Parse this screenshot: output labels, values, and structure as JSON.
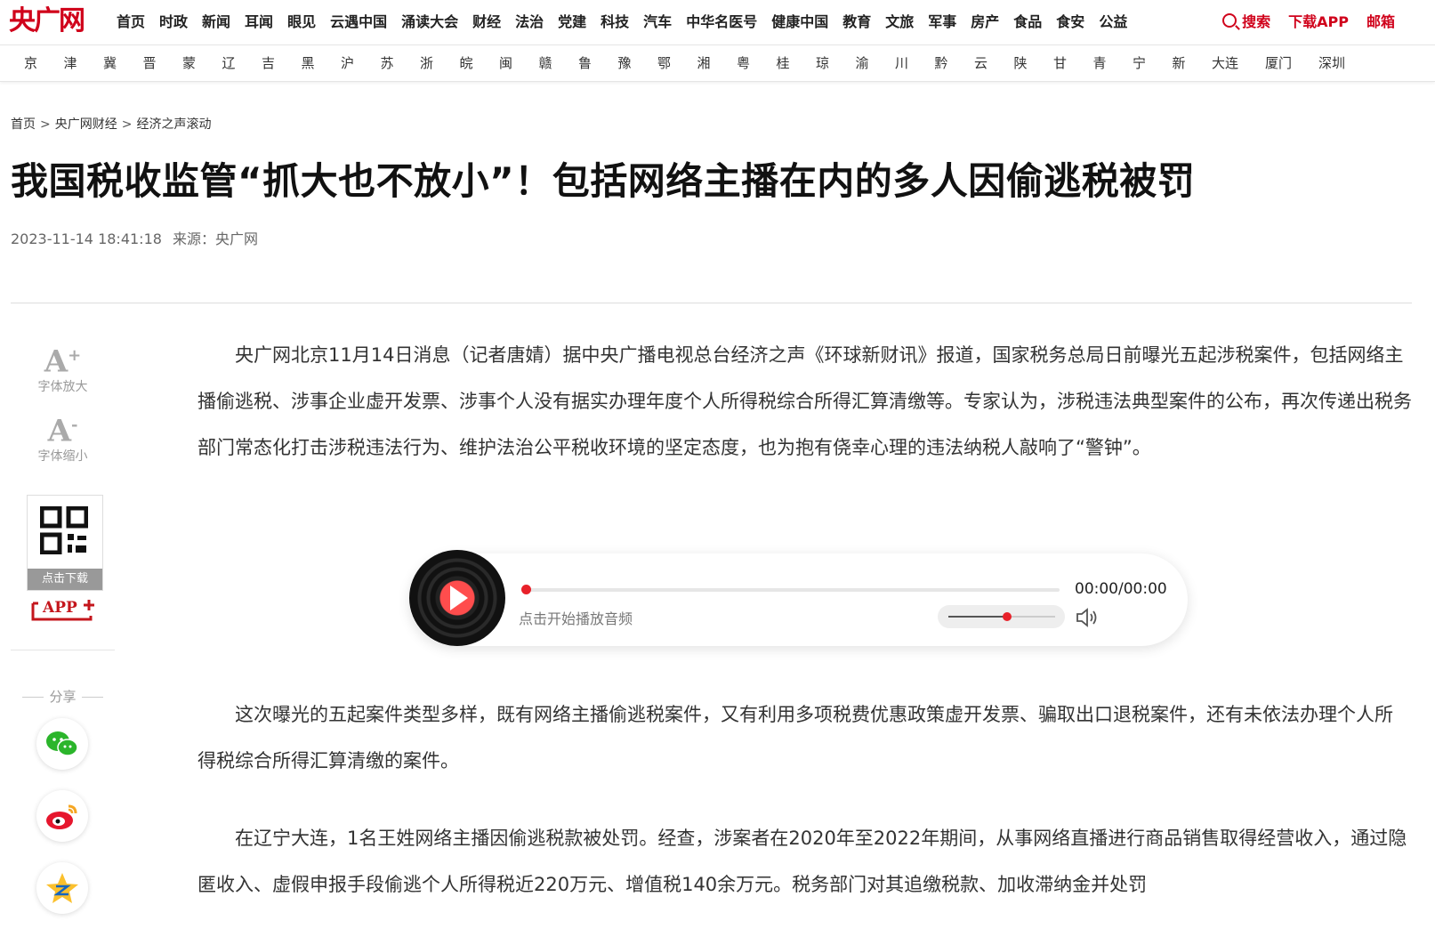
{
  "logo": "央广网",
  "nav": {
    "items": [
      "首页",
      "时政",
      "新闻",
      "耳闻",
      "眼见",
      "云遇中国",
      "涌读大会",
      "财经",
      "法治",
      "党建",
      "科技",
      "汽车",
      "中华名医号",
      "健康中国",
      "教育",
      "文旅",
      "军事",
      "房产",
      "食品",
      "食安",
      "公益"
    ],
    "search_label": "搜索",
    "download_label": "下载APP",
    "mail_label": "邮箱"
  },
  "regions": [
    "京",
    "津",
    "冀",
    "晋",
    "蒙",
    "辽",
    "吉",
    "黑",
    "沪",
    "苏",
    "浙",
    "皖",
    "闽",
    "赣",
    "鲁",
    "豫",
    "鄂",
    "湘",
    "粤",
    "桂",
    "琼",
    "渝",
    "川",
    "黔",
    "云",
    "陕",
    "甘",
    "青",
    "宁",
    "新",
    "大连",
    "厦门",
    "深圳"
  ],
  "breadcrumb": {
    "home": "首页",
    "section": "央广网财经",
    "sub": "经济之声滚动"
  },
  "article": {
    "title": "我国税收监管“抓大也不放小”！包括网络主播在内的多人因偷逃税被罚",
    "datetime": "2023-11-14 18:41:18",
    "source": "来源：央广网",
    "p1": "央广网北京11月14日消息（记者唐婧）据中央广播电视总台经济之声《环球新财讯》报道，国家税务总局日前曝光五起涉税案件，包括网络主播偷逃税、涉事企业虚开发票、涉事个人没有据实办理年度个人所得税综合所得汇算清缴等。专家认为，涉税违法典型案件的公布，再次传递出税务部门常态化打击涉税违法行为、维护法治公平税收环境的坚定态度，也为抱有侥幸心理的违法纳税人敲响了“警钟”。",
    "p2": "这次曝光的五起案件类型多样，既有网络主播偷逃税案件，又有利用多项税费优惠政策虚开发票、骗取出口退税案件，还有未依法办理个人所得税综合所得汇算清缴的案件。",
    "p3": "在辽宁大连，1名王姓网络主播因偷逃税款被处罚。经查，涉案者在2020年至2022年期间，从事网络直播进行商品销售取得经营收入，通过隐匿收入、虚假申报手段偷逃个人所得税近220万元、增值税140余万元。税务部门对其追缴税款、加收滞纳金并处罚"
  },
  "sidebar": {
    "font_up": "字体放大",
    "font_down": "字体缩小",
    "qr_caption": "点击下载",
    "app_badge": "APP",
    "share_label": "分享"
  },
  "audio": {
    "time": "00:00/00:00",
    "hint": "点击开始播放音频",
    "progress": 0,
    "volume": 0.55
  },
  "colors": {
    "brand": "#d0021b",
    "accent_dot": "#e8212a"
  }
}
